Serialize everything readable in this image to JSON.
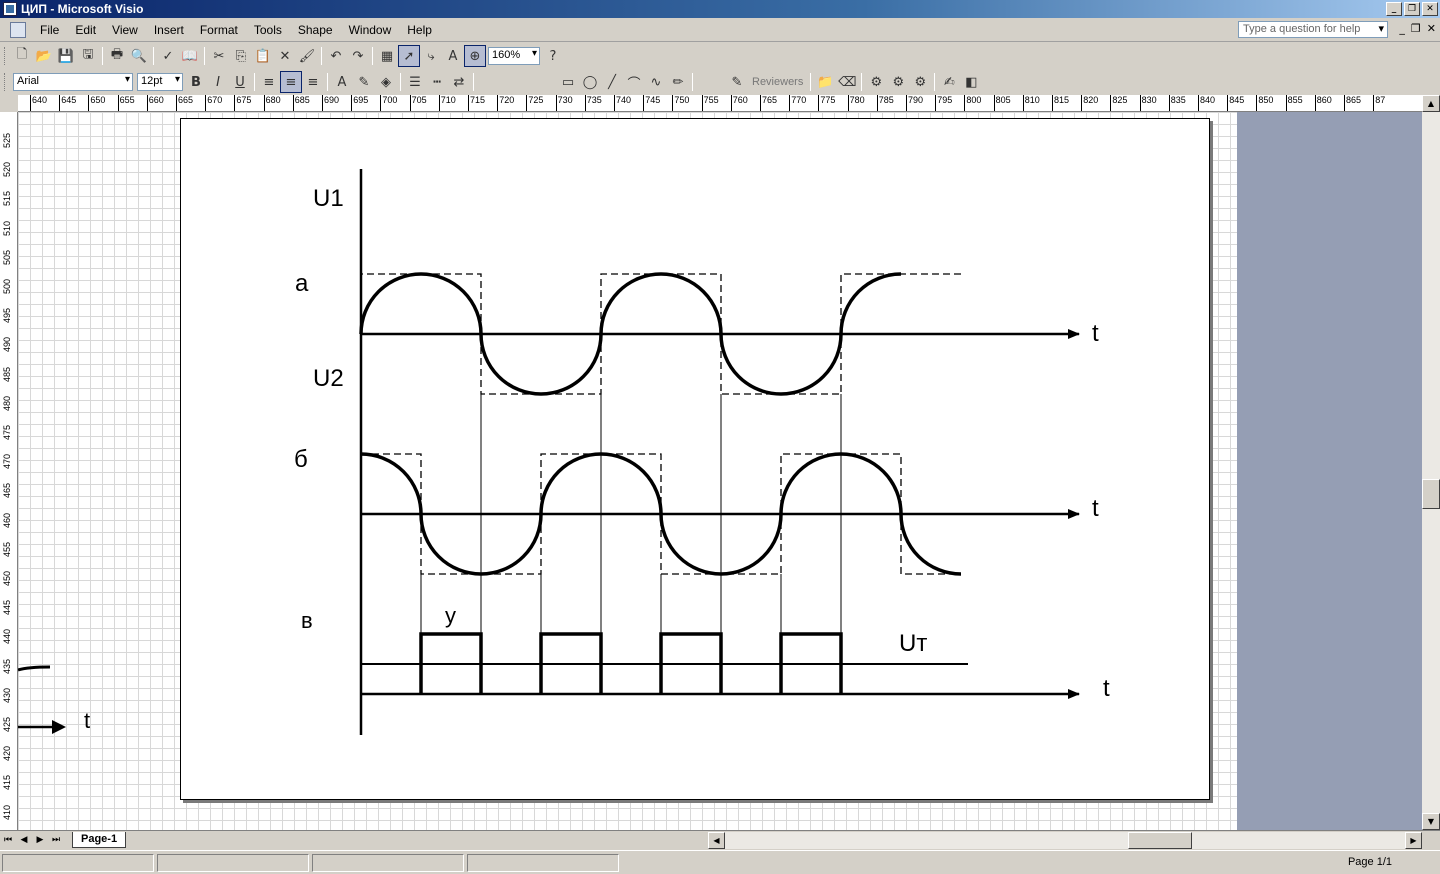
{
  "window": {
    "title": "ЦИП - Microsoft Visio"
  },
  "menu": {
    "items": [
      "File",
      "Edit",
      "View",
      "Insert",
      "Format",
      "Tools",
      "Shape",
      "Window",
      "Help"
    ],
    "help_placeholder": "Type a question for help"
  },
  "toolbar": {
    "zoom": "160%",
    "font": "Arial",
    "font_size": "12pt",
    "bold": "B",
    "italic": "I",
    "underline": "U",
    "reviewers": "Reviewers"
  },
  "ruler": {
    "h_ticks": [
      "640",
      "645",
      "650",
      "655",
      "660",
      "665",
      "670",
      "675",
      "680",
      "685",
      "690",
      "695",
      "700",
      "705",
      "710",
      "715",
      "720",
      "725",
      "730",
      "735",
      "740",
      "745",
      "750",
      "755",
      "760",
      "765",
      "770",
      "775",
      "780",
      "785",
      "790",
      "795",
      "800",
      "805",
      "810",
      "815",
      "820",
      "825",
      "830",
      "835",
      "840",
      "845",
      "850",
      "855",
      "860",
      "865",
      "87"
    ],
    "v_ticks": [
      "525",
      "520",
      "515",
      "510",
      "505",
      "500",
      "495",
      "490",
      "485",
      "480",
      "475",
      "470",
      "465",
      "460",
      "455",
      "450",
      "445",
      "440",
      "435",
      "430",
      "425",
      "420",
      "415",
      "410"
    ]
  },
  "diagram": {
    "u1_label": "U1",
    "u2_label": "U2",
    "label_a": "а",
    "label_b": "б",
    "label_v": "в",
    "label_y": "у",
    "label_ut": "Uт",
    "axis_t": "t",
    "offpage_t": "t"
  },
  "tabs": {
    "page": "Page-1"
  },
  "status": {
    "page_count": "Page 1/1"
  }
}
